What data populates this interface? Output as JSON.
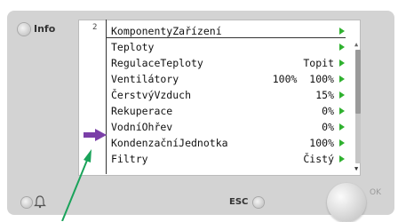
{
  "info_label": "Info",
  "page_number": "2",
  "header_title": "KomponentyZařízení",
  "rows": [
    {
      "label": "Teploty",
      "value": ""
    },
    {
      "label": "RegulaceTeploty",
      "value": "Topit"
    },
    {
      "label": "Ventilátory",
      "value": "100%  100%"
    },
    {
      "label": "ČerstvýVzduch",
      "value": "15%"
    },
    {
      "label": "Rekuperace",
      "value": "0%"
    },
    {
      "label": "VodníOhřev",
      "value": "0%"
    },
    {
      "label": "KondenzačníJednotka",
      "value": "100%"
    },
    {
      "label": "Filtry",
      "value": "Čistý"
    }
  ],
  "esc_label": "ESC",
  "ok_label": "OK",
  "colors": {
    "arrow_green": "#2fb12f",
    "pointer_purple": "#7b3fa8",
    "callout_green": "#1aa35a"
  },
  "icons": [
    "bell-icon",
    "scroll-up-icon",
    "scroll-down-icon"
  ]
}
